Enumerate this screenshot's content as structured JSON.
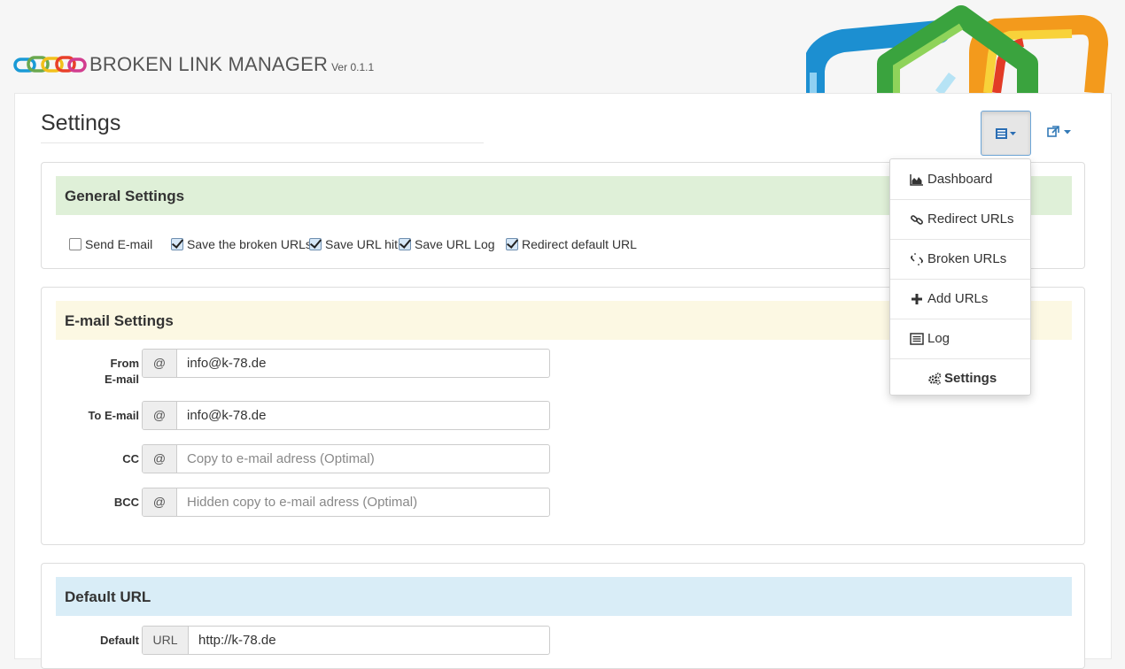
{
  "header": {
    "app_title": "BROKEN LINK MANAGER",
    "version": "Ver 0.1.1"
  },
  "page": {
    "title": "Settings"
  },
  "general": {
    "heading": "General Settings",
    "options": [
      {
        "label": "Send E-mail",
        "checked": false
      },
      {
        "label": "Save the broken URLs",
        "checked": true
      },
      {
        "label": "Save URL hit",
        "checked": true
      },
      {
        "label": "Save URL Log",
        "checked": true
      },
      {
        "label": "Redirect default URL",
        "checked": true
      }
    ]
  },
  "email": {
    "heading": "E-mail Settings",
    "addon": "@",
    "from": {
      "label_line1": "From",
      "label_line2": "E-mail",
      "value": "info@k-78.de",
      "placeholder": ""
    },
    "to": {
      "label": "To E-mail",
      "value": "info@k-78.de",
      "placeholder": ""
    },
    "cc": {
      "label": "CC",
      "value": "",
      "placeholder": "Copy to e-mail adress (Optimal)"
    },
    "bcc": {
      "label": "BCC",
      "value": "",
      "placeholder": "Hidden copy to e-mail adress (Optimal)"
    }
  },
  "default_url": {
    "heading": "Default URL",
    "label": "Default",
    "addon": "URL",
    "value": "http://k-78.de"
  },
  "menu": {
    "items": [
      {
        "label": "Dashboard",
        "icon": "area-chart-icon"
      },
      {
        "label": "Redirect URLs",
        "icon": "link-icon"
      },
      {
        "label": "Broken URLs",
        "icon": "broken-link-icon"
      },
      {
        "label": "Add URLs",
        "icon": "plus-icon"
      },
      {
        "label": "Log",
        "icon": "list-icon"
      },
      {
        "label": "Settings",
        "icon": "cogs-icon"
      }
    ]
  },
  "colors": {
    "general_head": "#dff0d8",
    "email_head": "#fcf8e3",
    "default_head": "#d9edf7",
    "accent": "#337ab7"
  }
}
